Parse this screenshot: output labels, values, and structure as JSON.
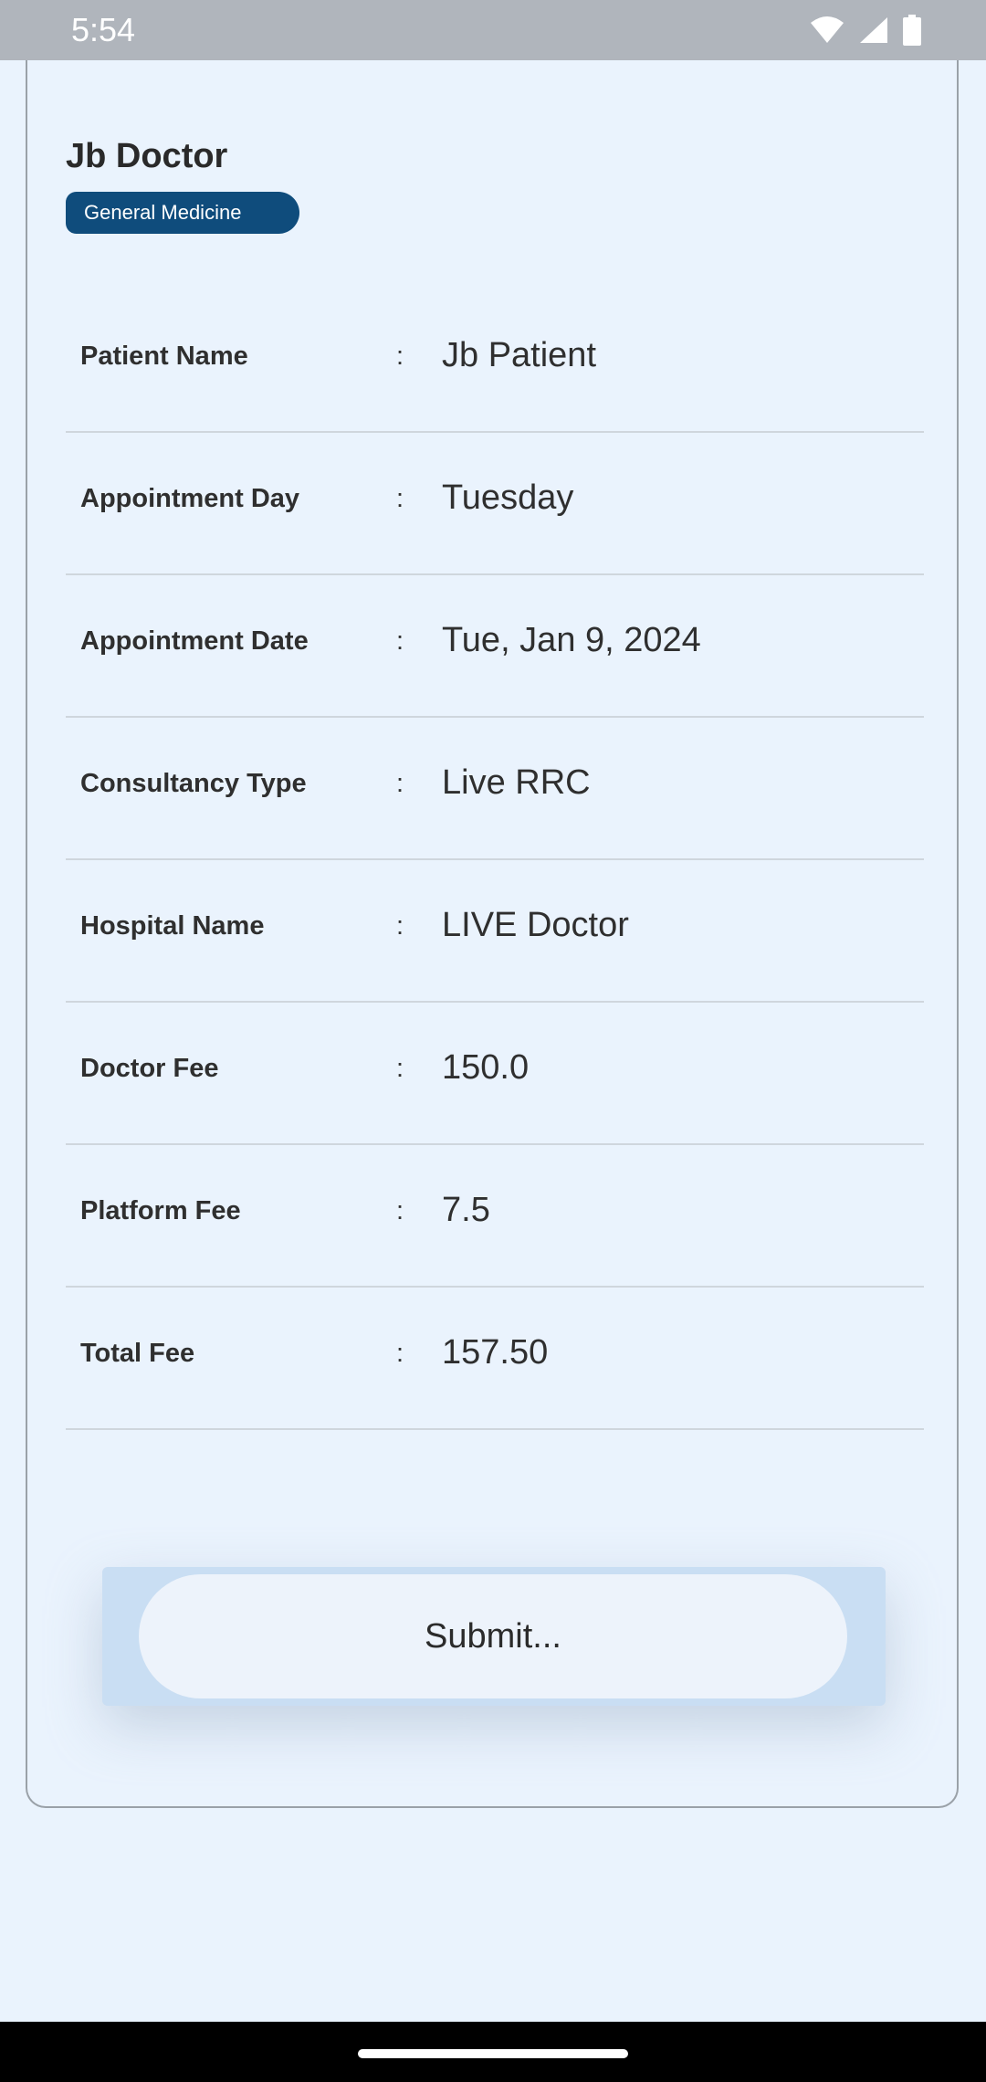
{
  "status_bar": {
    "time": "5:54",
    "icons": [
      "wifi-icon",
      "cellular-signal-icon",
      "battery-icon"
    ]
  },
  "doctor": {
    "name": "Jb Doctor",
    "specialty": "General Medicine"
  },
  "details": [
    {
      "label": "Patient Name",
      "separator": ":",
      "value": "Jb Patient"
    },
    {
      "label": "Appointment Day",
      "separator": ":",
      "value": "Tuesday"
    },
    {
      "label": "Appointment Date",
      "separator": ":",
      "value": "Tue, Jan 9, 2024"
    },
    {
      "label": "Consultancy Type",
      "separator": ":",
      "value": "Live RRC"
    },
    {
      "label": "Hospital Name",
      "separator": ":",
      "value": "LIVE Doctor"
    },
    {
      "label": "Doctor Fee",
      "separator": ":",
      "value": "150.0"
    },
    {
      "label": "Platform Fee",
      "separator": ":",
      "value": "7.5"
    },
    {
      "label": "Total Fee",
      "separator": ":",
      "value": "157.50"
    }
  ],
  "submit_label": "Submit...",
  "colors": {
    "background": "#eaf3fd",
    "badge": "#0f4c7c",
    "status_bar": "#b0b5bc",
    "nav_bar": "#000000"
  }
}
